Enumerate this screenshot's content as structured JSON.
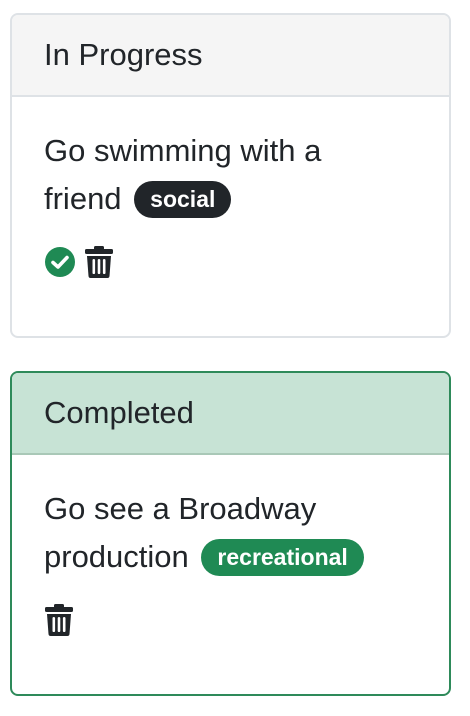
{
  "cards": [
    {
      "status": "In Progress",
      "task": "Go swimming with a friend",
      "tag": "social",
      "tag_color": "#212529",
      "actions": [
        "check-circle-icon",
        "trash-icon"
      ]
    },
    {
      "status": "Completed",
      "task": "Go see a Broadway production",
      "tag": "recreational",
      "tag_color": "#1f8a54",
      "actions": [
        "trash-icon"
      ]
    }
  ],
  "colors": {
    "completed_header_bg": "#c7e3d5",
    "completed_border": "#2e8a5a",
    "check_green": "#1f8a54",
    "trash": "#212529"
  }
}
